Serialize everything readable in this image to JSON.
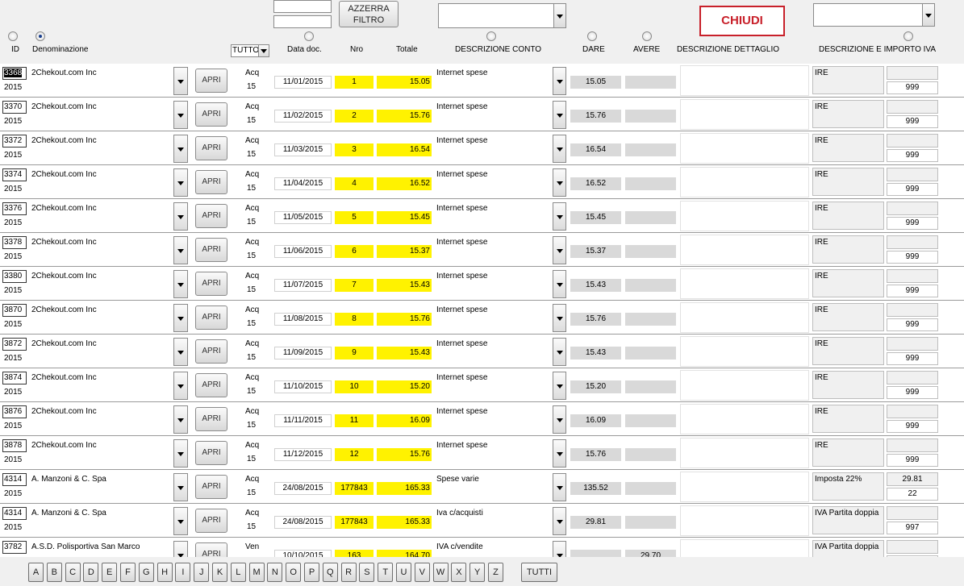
{
  "header": {
    "azzerra_label": "AZZERRA FILTRO",
    "chiudi_label": "CHIUDI",
    "tipo_filter_value": "TUTTO",
    "col_id": "ID",
    "col_denominazione": "Denominazione",
    "col_data_doc": "Data doc.",
    "col_nro": "Nro",
    "col_totale": "Totale",
    "col_descrizione_conto": "DESCRIZIONE CONTO",
    "col_dare": "DARE",
    "col_avere": "AVERE",
    "col_descrizione_dettaglio": "DESCRIZIONE DETTAGLIO",
    "col_descrizione_iva": "DESCRIZIONE E IMPORTO IVA",
    "selected_sort": "Denominazione"
  },
  "rows": [
    {
      "id": "3368",
      "year": "2015",
      "name": "2Chekout.com Inc",
      "open": "APRI",
      "tipo": "Acq",
      "tipo_num": "15",
      "date": "11/01/2015",
      "nro": "1",
      "totale": "15.05",
      "conto": "Internet spese",
      "dare": "15.05",
      "avere": "",
      "iva_desc": "IRE",
      "iva_imp": "",
      "iva_code": "999",
      "selected": true
    },
    {
      "id": "3370",
      "year": "2015",
      "name": "2Chekout.com Inc",
      "open": "APRI",
      "tipo": "Acq",
      "tipo_num": "15",
      "date": "11/02/2015",
      "nro": "2",
      "totale": "15.76",
      "conto": "Internet spese",
      "dare": "15.76",
      "avere": "",
      "iva_desc": "IRE",
      "iva_imp": "",
      "iva_code": "999"
    },
    {
      "id": "3372",
      "year": "2015",
      "name": "2Chekout.com Inc",
      "open": "APRI",
      "tipo": "Acq",
      "tipo_num": "15",
      "date": "11/03/2015",
      "nro": "3",
      "totale": "16.54",
      "conto": "Internet spese",
      "dare": "16.54",
      "avere": "",
      "iva_desc": "IRE",
      "iva_imp": "",
      "iva_code": "999"
    },
    {
      "id": "3374",
      "year": "2015",
      "name": "2Chekout.com Inc",
      "open": "APRI",
      "tipo": "Acq",
      "tipo_num": "15",
      "date": "11/04/2015",
      "nro": "4",
      "totale": "16.52",
      "conto": "Internet spese",
      "dare": "16.52",
      "avere": "",
      "iva_desc": "IRE",
      "iva_imp": "",
      "iva_code": "999"
    },
    {
      "id": "3376",
      "year": "2015",
      "name": "2Chekout.com Inc",
      "open": "APRI",
      "tipo": "Acq",
      "tipo_num": "15",
      "date": "11/05/2015",
      "nro": "5",
      "totale": "15.45",
      "conto": "Internet spese",
      "dare": "15.45",
      "avere": "",
      "iva_desc": "IRE",
      "iva_imp": "",
      "iva_code": "999"
    },
    {
      "id": "3378",
      "year": "2015",
      "name": "2Chekout.com Inc",
      "open": "APRI",
      "tipo": "Acq",
      "tipo_num": "15",
      "date": "11/06/2015",
      "nro": "6",
      "totale": "15.37",
      "conto": "Internet spese",
      "dare": "15.37",
      "avere": "",
      "iva_desc": "IRE",
      "iva_imp": "",
      "iva_code": "999"
    },
    {
      "id": "3380",
      "year": "2015",
      "name": "2Chekout.com Inc",
      "open": "APRI",
      "tipo": "Acq",
      "tipo_num": "15",
      "date": "11/07/2015",
      "nro": "7",
      "totale": "15.43",
      "conto": "Internet spese",
      "dare": "15.43",
      "avere": "",
      "iva_desc": "IRE",
      "iva_imp": "",
      "iva_code": "999"
    },
    {
      "id": "3870",
      "year": "2015",
      "name": "2Chekout.com Inc",
      "open": "APRI",
      "tipo": "Acq",
      "tipo_num": "15",
      "date": "11/08/2015",
      "nro": "8",
      "totale": "15.76",
      "conto": "Internet spese",
      "dare": "15.76",
      "avere": "",
      "iva_desc": "IRE",
      "iva_imp": "",
      "iva_code": "999"
    },
    {
      "id": "3872",
      "year": "2015",
      "name": "2Chekout.com Inc",
      "open": "APRI",
      "tipo": "Acq",
      "tipo_num": "15",
      "date": "11/09/2015",
      "nro": "9",
      "totale": "15.43",
      "conto": "Internet spese",
      "dare": "15.43",
      "avere": "",
      "iva_desc": "IRE",
      "iva_imp": "",
      "iva_code": "999"
    },
    {
      "id": "3874",
      "year": "2015",
      "name": "2Chekout.com Inc",
      "open": "APRI",
      "tipo": "Acq",
      "tipo_num": "15",
      "date": "11/10/2015",
      "nro": "10",
      "totale": "15.20",
      "conto": "Internet spese",
      "dare": "15.20",
      "avere": "",
      "iva_desc": "IRE",
      "iva_imp": "",
      "iva_code": "999"
    },
    {
      "id": "3876",
      "year": "2015",
      "name": "2Chekout.com Inc",
      "open": "APRI",
      "tipo": "Acq",
      "tipo_num": "15",
      "date": "11/11/2015",
      "nro": "11",
      "totale": "16.09",
      "conto": "Internet spese",
      "dare": "16.09",
      "avere": "",
      "iva_desc": "IRE",
      "iva_imp": "",
      "iva_code": "999"
    },
    {
      "id": "3878",
      "year": "2015",
      "name": "2Chekout.com Inc",
      "open": "APRI",
      "tipo": "Acq",
      "tipo_num": "15",
      "date": "11/12/2015",
      "nro": "12",
      "totale": "15.76",
      "conto": "Internet spese",
      "dare": "15.76",
      "avere": "",
      "iva_desc": "IRE",
      "iva_imp": "",
      "iva_code": "999"
    },
    {
      "id": "4314",
      "year": "2015",
      "name": "A. Manzoni & C. Spa",
      "open": "APRI",
      "tipo": "Acq",
      "tipo_num": "15",
      "date": "24/08/2015",
      "nro": "177843",
      "totale": "165.33",
      "conto": "Spese varie",
      "dare": "135.52",
      "avere": "",
      "iva_desc": "Imposta 22%",
      "iva_imp": "29.81",
      "iva_code": "22"
    },
    {
      "id": "4314",
      "year": "2015",
      "name": "A. Manzoni & C. Spa",
      "open": "APRI",
      "tipo": "Acq",
      "tipo_num": "15",
      "date": "24/08/2015",
      "nro": "177843",
      "totale": "165.33",
      "conto": "Iva c/acquisti",
      "dare": "29.81",
      "avere": "",
      "iva_desc": "IVA Partita doppia",
      "iva_imp": "",
      "iva_code": "997"
    },
    {
      "id": "3782",
      "year": "",
      "name": "A.S.D. Polisportiva San Marco",
      "open": "APRI",
      "tipo": "Ven",
      "tipo_num": "",
      "date": "10/10/2015",
      "nro": "163",
      "totale": "164.70",
      "conto": "IVA c/vendite",
      "dare": "",
      "avere": "29.70",
      "iva_desc": "IVA Partita doppia",
      "iva_imp": "",
      "iva_code": ""
    }
  ],
  "letters": [
    "A",
    "B",
    "C",
    "D",
    "E",
    "F",
    "G",
    "H",
    "I",
    "J",
    "K",
    "L",
    "M",
    "N",
    "O",
    "P",
    "Q",
    "R",
    "S",
    "T",
    "U",
    "V",
    "W",
    "X",
    "Y",
    "Z"
  ],
  "tutti_label": "TUTTI",
  "colors": {
    "highlight": "#fff200",
    "chiudi": "#c8202a",
    "field_gray": "#d9d9d9"
  }
}
